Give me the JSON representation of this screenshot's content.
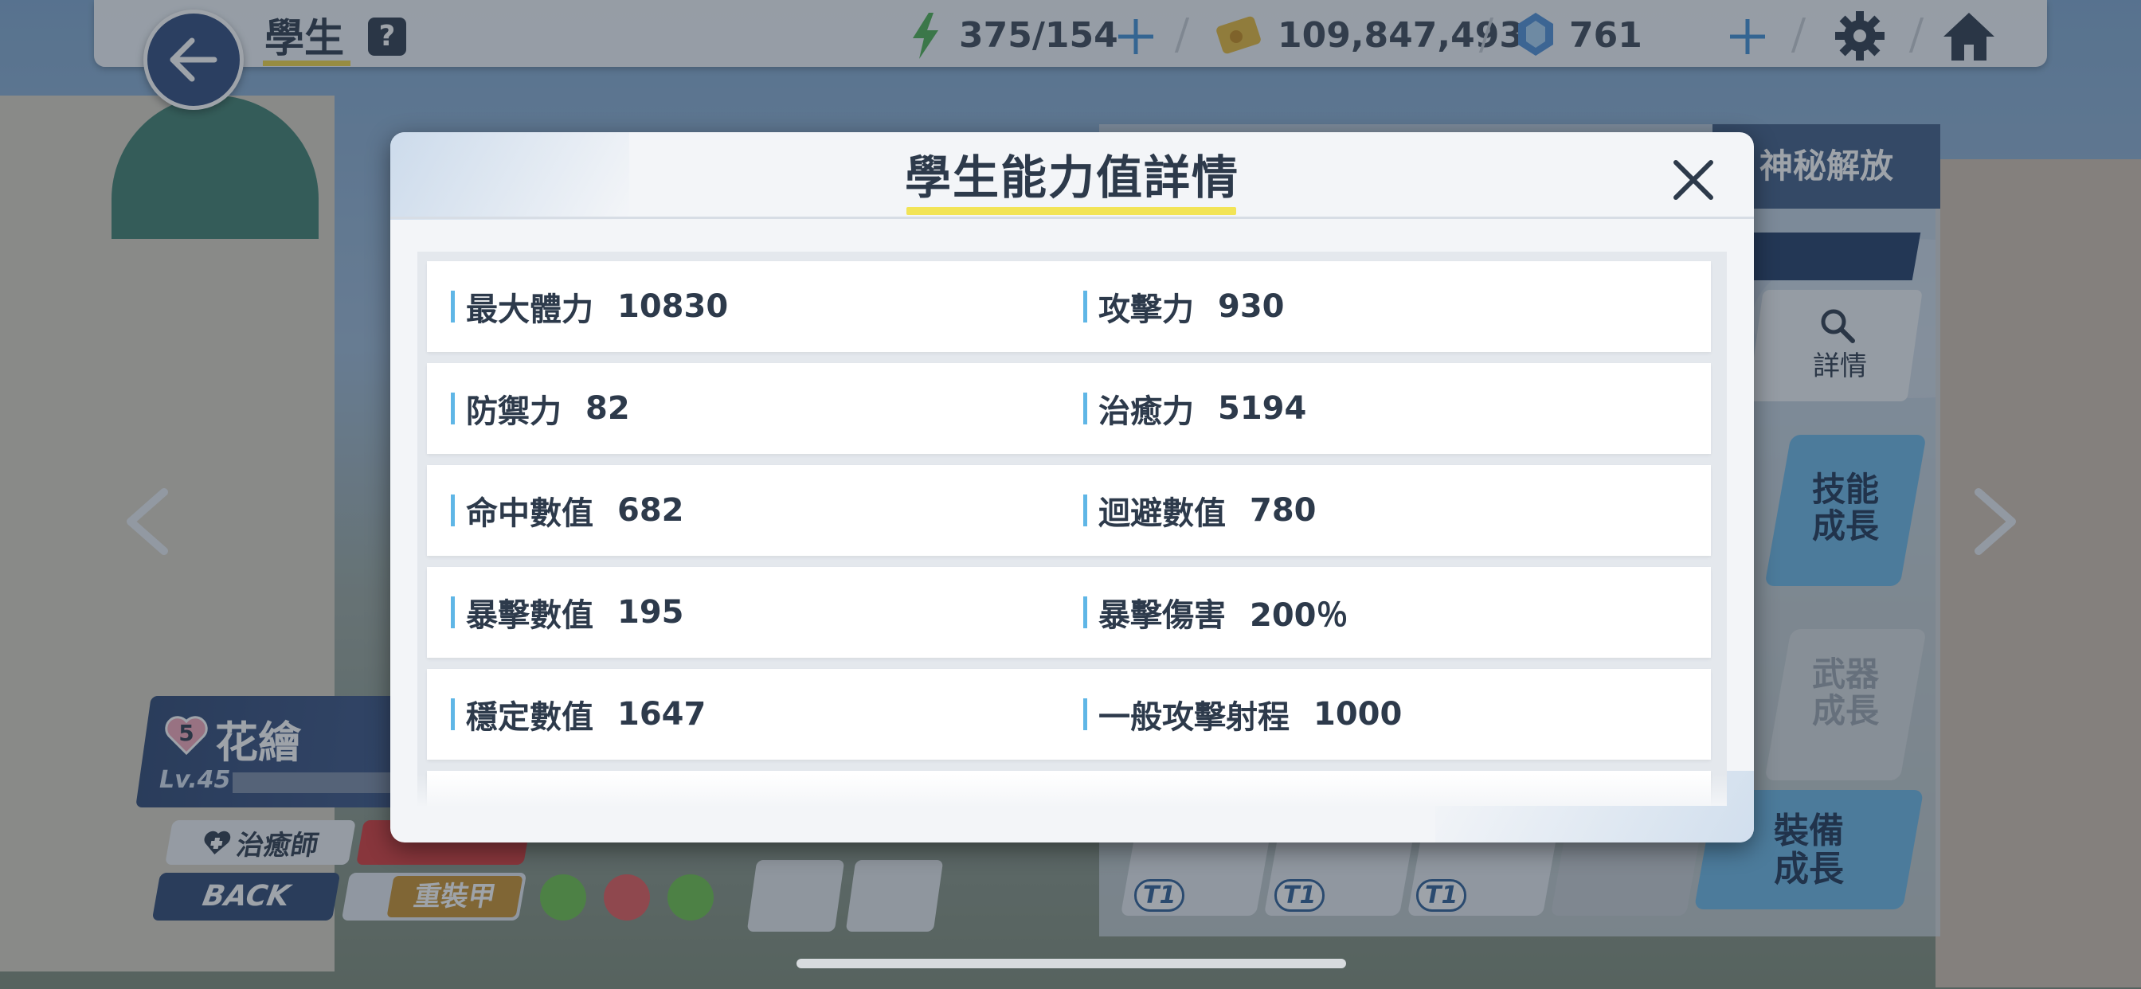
{
  "topbar": {
    "title": "學生",
    "help": "?",
    "ap": "375/154",
    "credits": "109,847,493",
    "gems": "761"
  },
  "student": {
    "bond_level": "5",
    "name": "花繪",
    "level": "Lv.45",
    "role": "治癒師",
    "back_label": "BACK",
    "armor": "重裝甲"
  },
  "right_panel": {
    "tab_label": "神秘解放",
    "detail_label": "詳情",
    "skill_button": "技能\n成長",
    "weapon_button": "武器\n成長",
    "equip_button": "裝備\n成長",
    "tier_labels": [
      "T1",
      "T1",
      "T1"
    ]
  },
  "modal": {
    "title": "學生能力值詳情",
    "rows": [
      [
        {
          "label": "最大體力",
          "value": "10830"
        },
        {
          "label": "攻擊力",
          "value": "930"
        }
      ],
      [
        {
          "label": "防禦力",
          "value": "82"
        },
        {
          "label": "治癒力",
          "value": "5194"
        }
      ],
      [
        {
          "label": "命中數值",
          "value": "682"
        },
        {
          "label": "迴避數值",
          "value": "780"
        }
      ],
      [
        {
          "label": "暴擊數值",
          "value": "195"
        },
        {
          "label": "暴擊傷害",
          "value": "200％"
        }
      ],
      [
        {
          "label": "穩定數值",
          "value": "1647"
        },
        {
          "label": "一般攻擊射程",
          "value": "1000"
        }
      ]
    ]
  },
  "colors": {
    "accent_blue": "#5fb6e6",
    "title_underline": "#f2e457",
    "navy": "#2d4572"
  }
}
